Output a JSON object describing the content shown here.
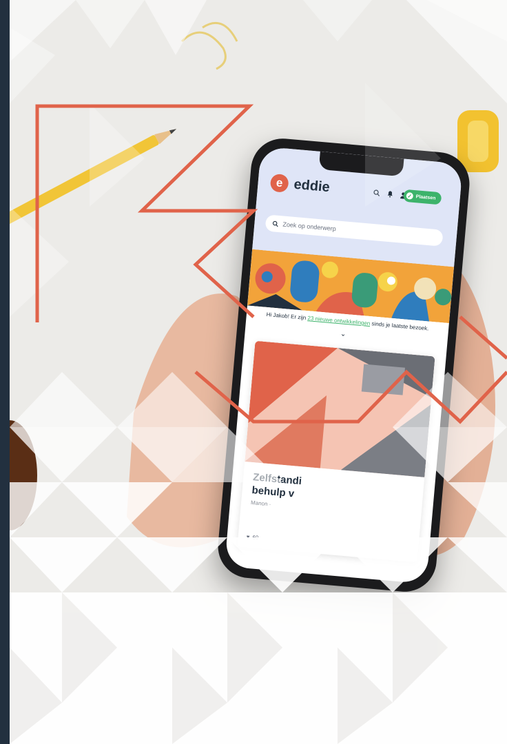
{
  "app": {
    "logo_letter": "e",
    "name": "eddie",
    "post_button": "Plaatsen",
    "search_placeholder": "Zoek op onderwerp"
  },
  "greeting": {
    "prefix": "Hi Jakob!  Er zijn ",
    "highlight": "23 nieuwe ontwikkelingen",
    "suffix": " sinds je laatste bezoek."
  },
  "card": {
    "title_line1": "Zelfstandi",
    "title_line2": "behulp v",
    "author": "Manon ·",
    "likes": "60"
  },
  "icons": [
    "search-icon",
    "bell-icon",
    "user-icon",
    "check-icon",
    "chevron-down-icon",
    "heart-icon"
  ],
  "colors": {
    "accent": "#e0634a",
    "dark": "#22303f",
    "green": "#3db36b",
    "header": "#dfe5f7"
  }
}
